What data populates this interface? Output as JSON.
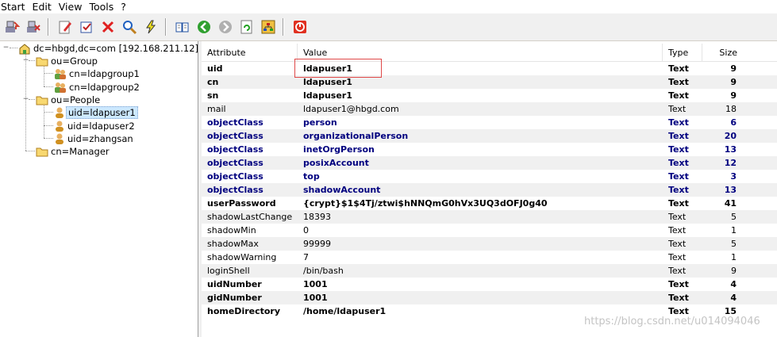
{
  "menu": [
    "Start",
    "Edit",
    "View",
    "Tools",
    "?"
  ],
  "toolbar_icons": [
    "connect-icon",
    "disconnect-icon",
    "edit-icon",
    "check-icon",
    "delete-icon",
    "search-icon",
    "lightning-icon",
    "book-icon",
    "back-icon",
    "forward-icon",
    "refresh-icon",
    "tree-icon",
    "power-icon"
  ],
  "tree": {
    "root": "dc=hbgd,dc=com [192.168.211.12]",
    "group": "ou=Group",
    "group_children": [
      "cn=ldapgroup1",
      "cn=ldapgroup2"
    ],
    "people": "ou=People",
    "people_children": [
      "uid=ldapuser1",
      "uid=ldapuser2",
      "uid=zhangsan"
    ],
    "manager": "cn=Manager",
    "selected": "uid=ldapuser1"
  },
  "grid": {
    "headers": {
      "attribute": "Attribute",
      "value": "Value",
      "type": "Type",
      "size": "Size"
    },
    "rows": [
      {
        "attr": "uid",
        "value": "ldapuser1",
        "type": "Text",
        "size": "9",
        "style": "bold"
      },
      {
        "attr": "cn",
        "value": "ldapuser1",
        "type": "Text",
        "size": "9",
        "style": "bold"
      },
      {
        "attr": "sn",
        "value": "ldapuser1",
        "type": "Text",
        "size": "9",
        "style": "bold"
      },
      {
        "attr": "mail",
        "value": "ldapuser1@hbgd.com",
        "type": "Text",
        "size": "18",
        "style": "normal"
      },
      {
        "attr": "objectClass",
        "value": "person",
        "type": "Text",
        "size": "6",
        "style": "blue"
      },
      {
        "attr": "objectClass",
        "value": "organizationalPerson",
        "type": "Text",
        "size": "20",
        "style": "blue"
      },
      {
        "attr": "objectClass",
        "value": "inetOrgPerson",
        "type": "Text",
        "size": "13",
        "style": "blue"
      },
      {
        "attr": "objectClass",
        "value": "posixAccount",
        "type": "Text",
        "size": "12",
        "style": "blue"
      },
      {
        "attr": "objectClass",
        "value": "top",
        "type": "Text",
        "size": "3",
        "style": "blue"
      },
      {
        "attr": "objectClass",
        "value": "shadowAccount",
        "type": "Text",
        "size": "13",
        "style": "blue"
      },
      {
        "attr": "userPassword",
        "value": "{crypt}$1$4Tj/ztwi$hNNQmG0hVx3UQ3dOFJ0g40",
        "type": "Text",
        "size": "41",
        "style": "bold"
      },
      {
        "attr": "shadowLastChange",
        "value": "18393",
        "type": "Text",
        "size": "5",
        "style": "normal"
      },
      {
        "attr": "shadowMin",
        "value": "0",
        "type": "Text",
        "size": "1",
        "style": "normal"
      },
      {
        "attr": "shadowMax",
        "value": "99999",
        "type": "Text",
        "size": "5",
        "style": "normal"
      },
      {
        "attr": "shadowWarning",
        "value": "7",
        "type": "Text",
        "size": "1",
        "style": "normal"
      },
      {
        "attr": "loginShell",
        "value": "/bin/bash",
        "type": "Text",
        "size": "9",
        "style": "normal"
      },
      {
        "attr": "uidNumber",
        "value": "1001",
        "type": "Text",
        "size": "4",
        "style": "bold"
      },
      {
        "attr": "gidNumber",
        "value": "1001",
        "type": "Text",
        "size": "4",
        "style": "bold"
      },
      {
        "attr": "homeDirectory",
        "value": "/home/ldapuser1",
        "type": "Text",
        "size": "15",
        "style": "bold"
      }
    ]
  },
  "watermark": "https://blog.csdn.net/u014094046",
  "colors": {
    "blue_attr": "#00007f",
    "selection": "#cce8ff",
    "highlight_box": "#e04848"
  }
}
